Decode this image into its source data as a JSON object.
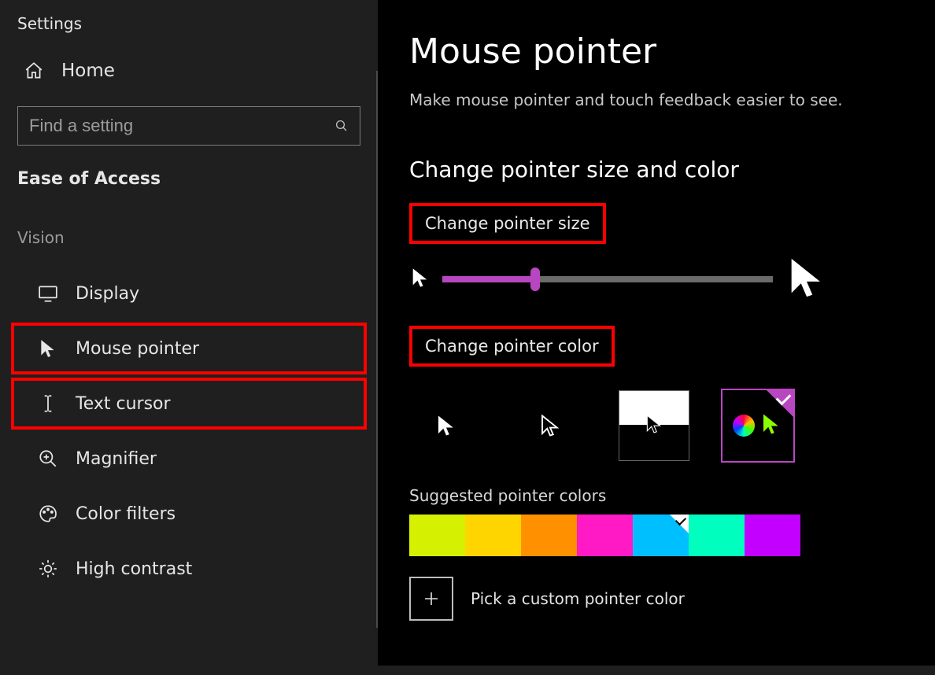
{
  "app_title": "Settings",
  "home_label": "Home",
  "search": {
    "placeholder": "Find a setting"
  },
  "category_header": "Ease of Access",
  "group_label": "Vision",
  "nav": {
    "display": "Display",
    "mouse_pointer": "Mouse pointer",
    "text_cursor": "Text cursor",
    "magnifier": "Magnifier",
    "color_filters": "Color filters",
    "high_contrast": "High contrast"
  },
  "page": {
    "title": "Mouse pointer",
    "subtitle": "Make mouse pointer and touch feedback easier to see."
  },
  "section_title": "Change pointer size and color",
  "size_label": "Change pointer size",
  "color_label": "Change pointer color",
  "slider_percent": 28,
  "accent": "#b946c1",
  "suggested_label": "Suggested pointer colors",
  "suggested_colors": [
    "#d5f000",
    "#ffd500",
    "#ff9100",
    "#ff1ac6",
    "#00bfff",
    "#00ffbf",
    "#c300ff"
  ],
  "suggested_selected_index": 4,
  "custom_label": "Pick a custom pointer color"
}
